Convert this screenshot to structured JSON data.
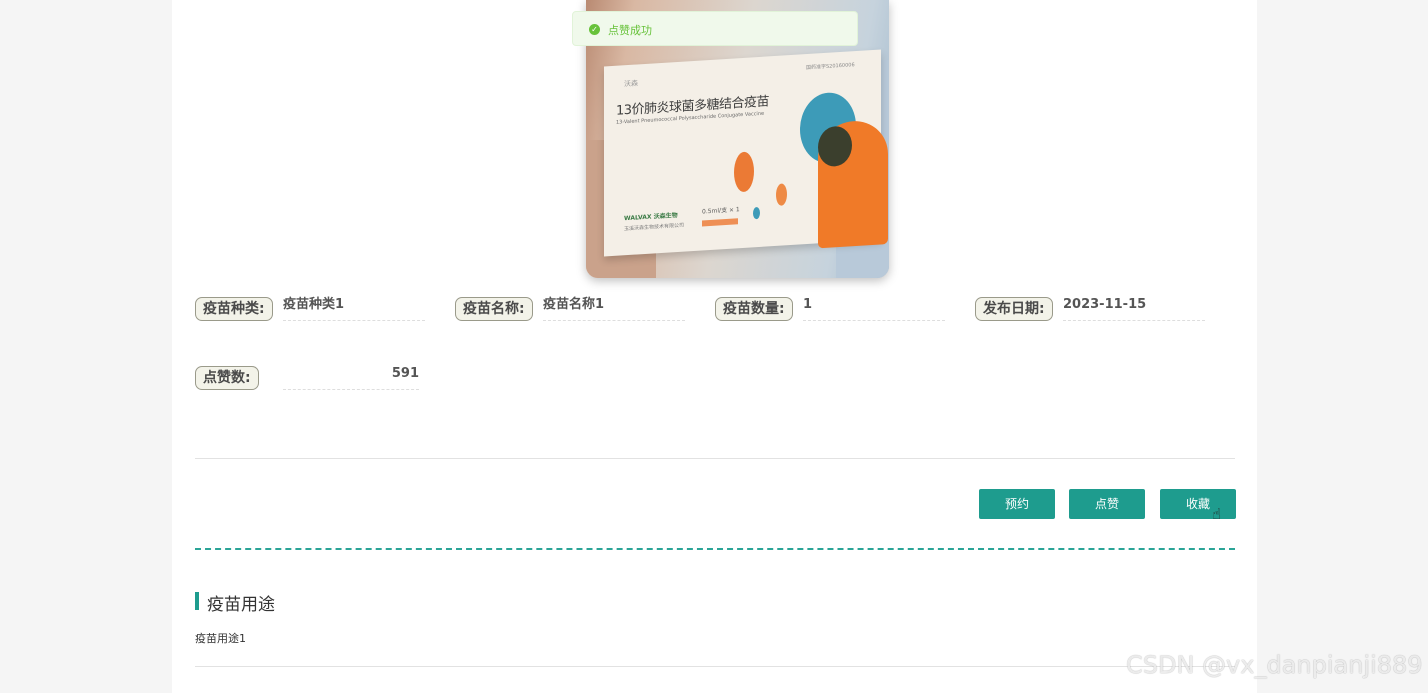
{
  "toast": {
    "message": "点赞成功",
    "icon": "check-circle-icon"
  },
  "product_image": {
    "box_logo": "沃森",
    "box_corner": "国药准字S20160006",
    "box_title": "13价肺炎球菌多糖结合疫苗",
    "box_subtitle": "13-Valent Pneumococcal Polysaccharide Conjugate Vaccine",
    "box_brand": "WALVAX 沃森生物",
    "box_maker": "玉溪沃森生物技术有限公司",
    "box_dose": "0.5ml/支 × 1"
  },
  "details": {
    "type_label": "疫苗种类:",
    "type_value": "疫苗种类1",
    "name_label": "疫苗名称:",
    "name_value": "疫苗名称1",
    "quantity_label": "疫苗数量:",
    "quantity_value": "1",
    "date_label": "发布日期:",
    "date_value": "2023-11-15",
    "likes_label": "点赞数:",
    "likes_value": "591"
  },
  "actions": {
    "reserve": "预约",
    "like": "点赞",
    "favorite": "收藏"
  },
  "section": {
    "title": "疫苗用途",
    "content": "疫苗用途1"
  },
  "watermark": "CSDN @vx_danpianji889",
  "colors": {
    "accent": "#1e9c8e",
    "success": "#67c23a",
    "toast_bg": "#f0f9eb",
    "page_bg": "#f5f5f5",
    "tag_bg": "#f3f3e9"
  }
}
